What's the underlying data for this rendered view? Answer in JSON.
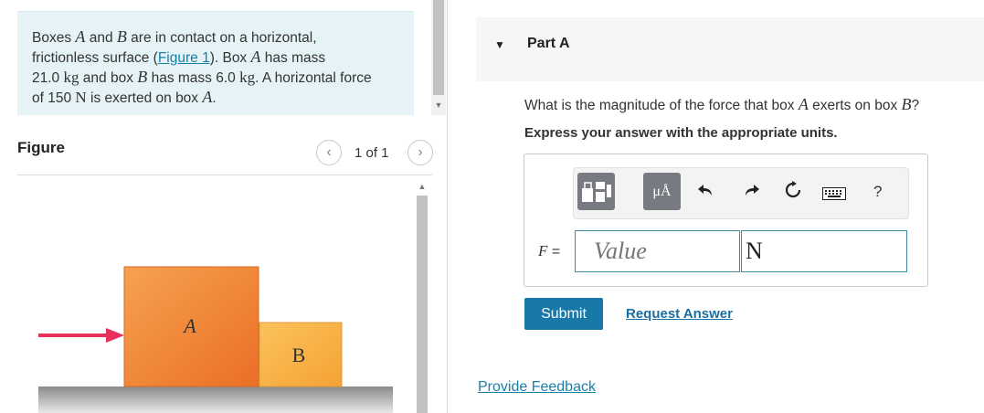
{
  "problem": {
    "line1_prefix": "Boxes ",
    "var_a": "A",
    "and": " and ",
    "var_b": "B",
    "line1_suffix": " are in contact on a horizontal,",
    "line2_prefix": "frictionless surface (",
    "figure_link": "Figure 1",
    "line2_mid": "). Box ",
    "line2_suffix": " has mass",
    "mass_a": "21.0",
    "unit_kg": "kg",
    "line3_mid": " and box ",
    "line3_has": " has mass ",
    "mass_b": "6.0",
    "line3_suffix": ". A horizontal force",
    "line4_prefix": "of ",
    "force_value": "150",
    "unit_n": "N",
    "line4_mid": " is exerted on box ",
    "period": "."
  },
  "figure": {
    "title": "Figure",
    "pager_text": "1 of 1",
    "prev_icon": "chevron-left-icon",
    "next_icon": "chevron-right-icon",
    "box_a_label": "A",
    "box_b_label": "B",
    "colors": {
      "box_a_fill": "#f0883a",
      "box_b_fill": "#f9b34a",
      "arrow": "#e8305c",
      "ground": "#9a9a9a"
    }
  },
  "part": {
    "title": "Part A",
    "question_prefix": "What is the magnitude of the force that box ",
    "question_a": "A",
    "question_mid": " exerts on box ",
    "question_b": "B",
    "question_suffix": "?",
    "instruction": "Express your answer with the appropriate units."
  },
  "answer": {
    "variable": "F",
    "equals": " =",
    "value_placeholder": "Value",
    "unit_value": "N",
    "units_button": "μÅ",
    "help": "?"
  },
  "actions": {
    "submit": "Submit",
    "request_answer": "Request Answer",
    "provide_feedback": "Provide Feedback"
  },
  "colors": {
    "accent": "#1879a8",
    "problem_bg": "#e5f3f6",
    "input_border": "#3f8da7"
  }
}
